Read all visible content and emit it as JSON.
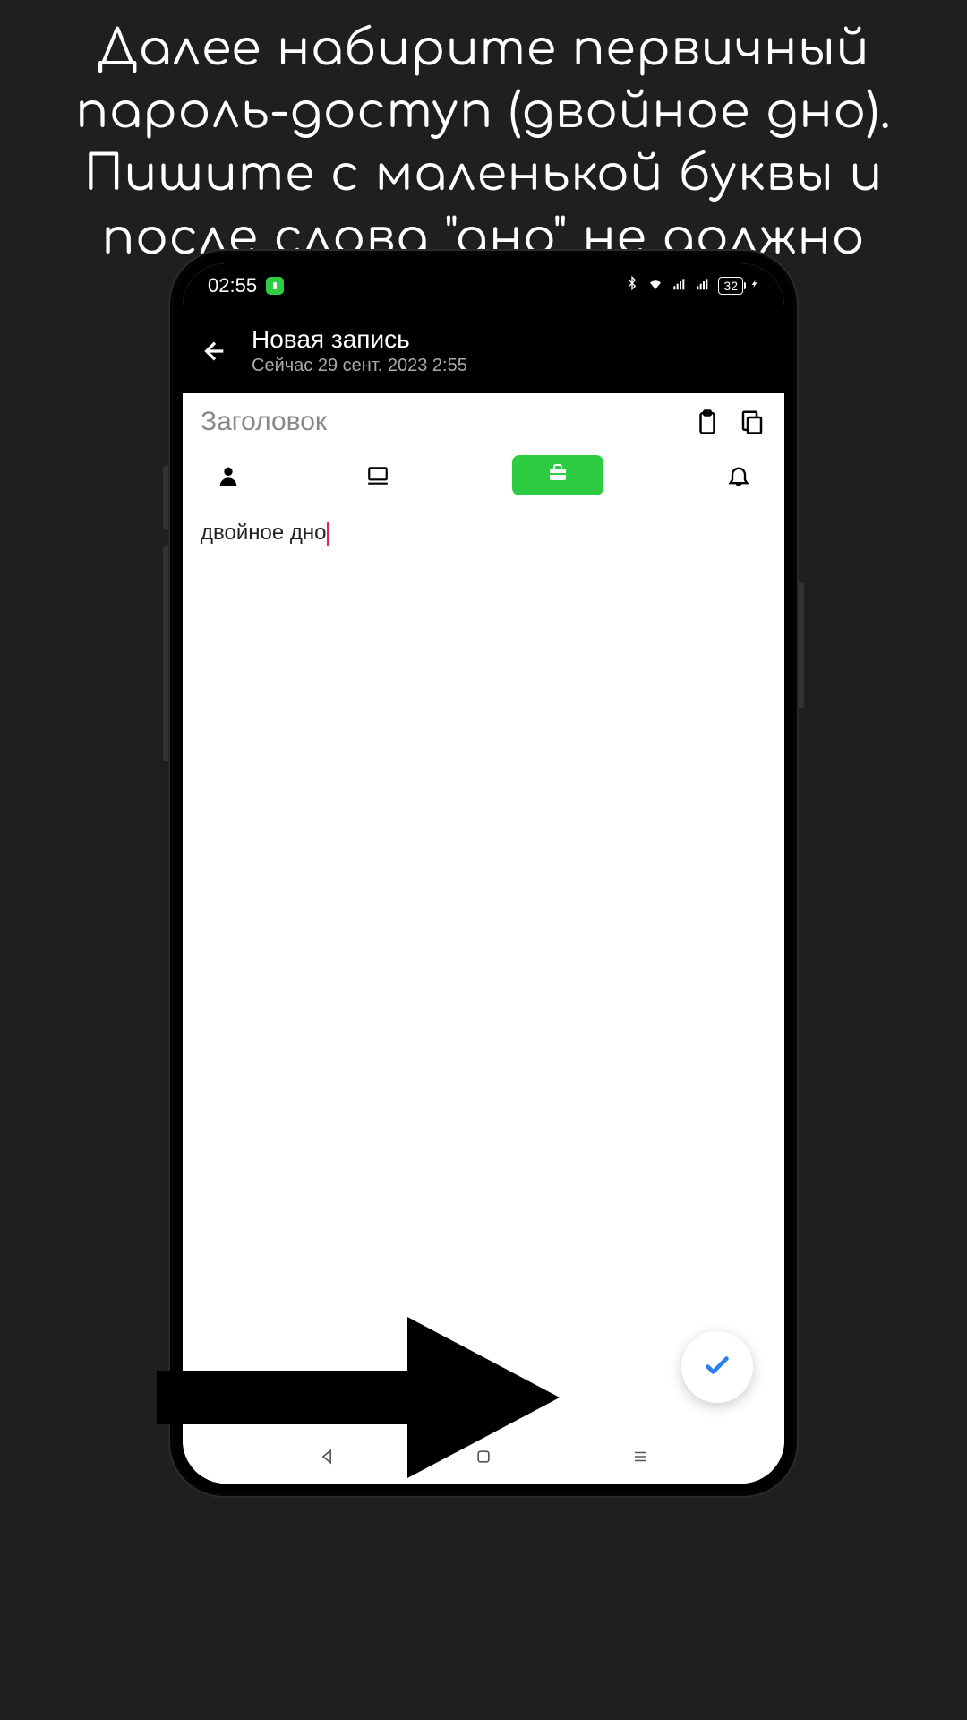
{
  "instruction": "Далее набирите первичный пароль-доступ (двойное дно). Пишите с маленькой буквы и после слова \"дно\" не должно быть пробела",
  "status_bar": {
    "time": "02:55",
    "battery_percent": "32",
    "bluetooth_icon": "bluetooth",
    "wifi_icon": "wifi",
    "signal_icon": "signal"
  },
  "app_header": {
    "title": "Новая запись",
    "subtitle": "Сейчас 29 сент. 2023  2:55"
  },
  "note": {
    "title_placeholder": "Заголовок",
    "body_text": "двойное дно"
  },
  "icons": {
    "back": "arrow-left",
    "clipboard": "clipboard",
    "copy": "copy",
    "person": "person",
    "laptop": "laptop",
    "briefcase": "briefcase",
    "bell": "bell",
    "check": "check"
  },
  "nav": {
    "back": "triangle",
    "home": "square",
    "recent": "menu"
  },
  "colors": {
    "accent_green": "#2ecc40",
    "check_blue": "#2a7ef0",
    "cursor_pink": "#e91e63"
  }
}
